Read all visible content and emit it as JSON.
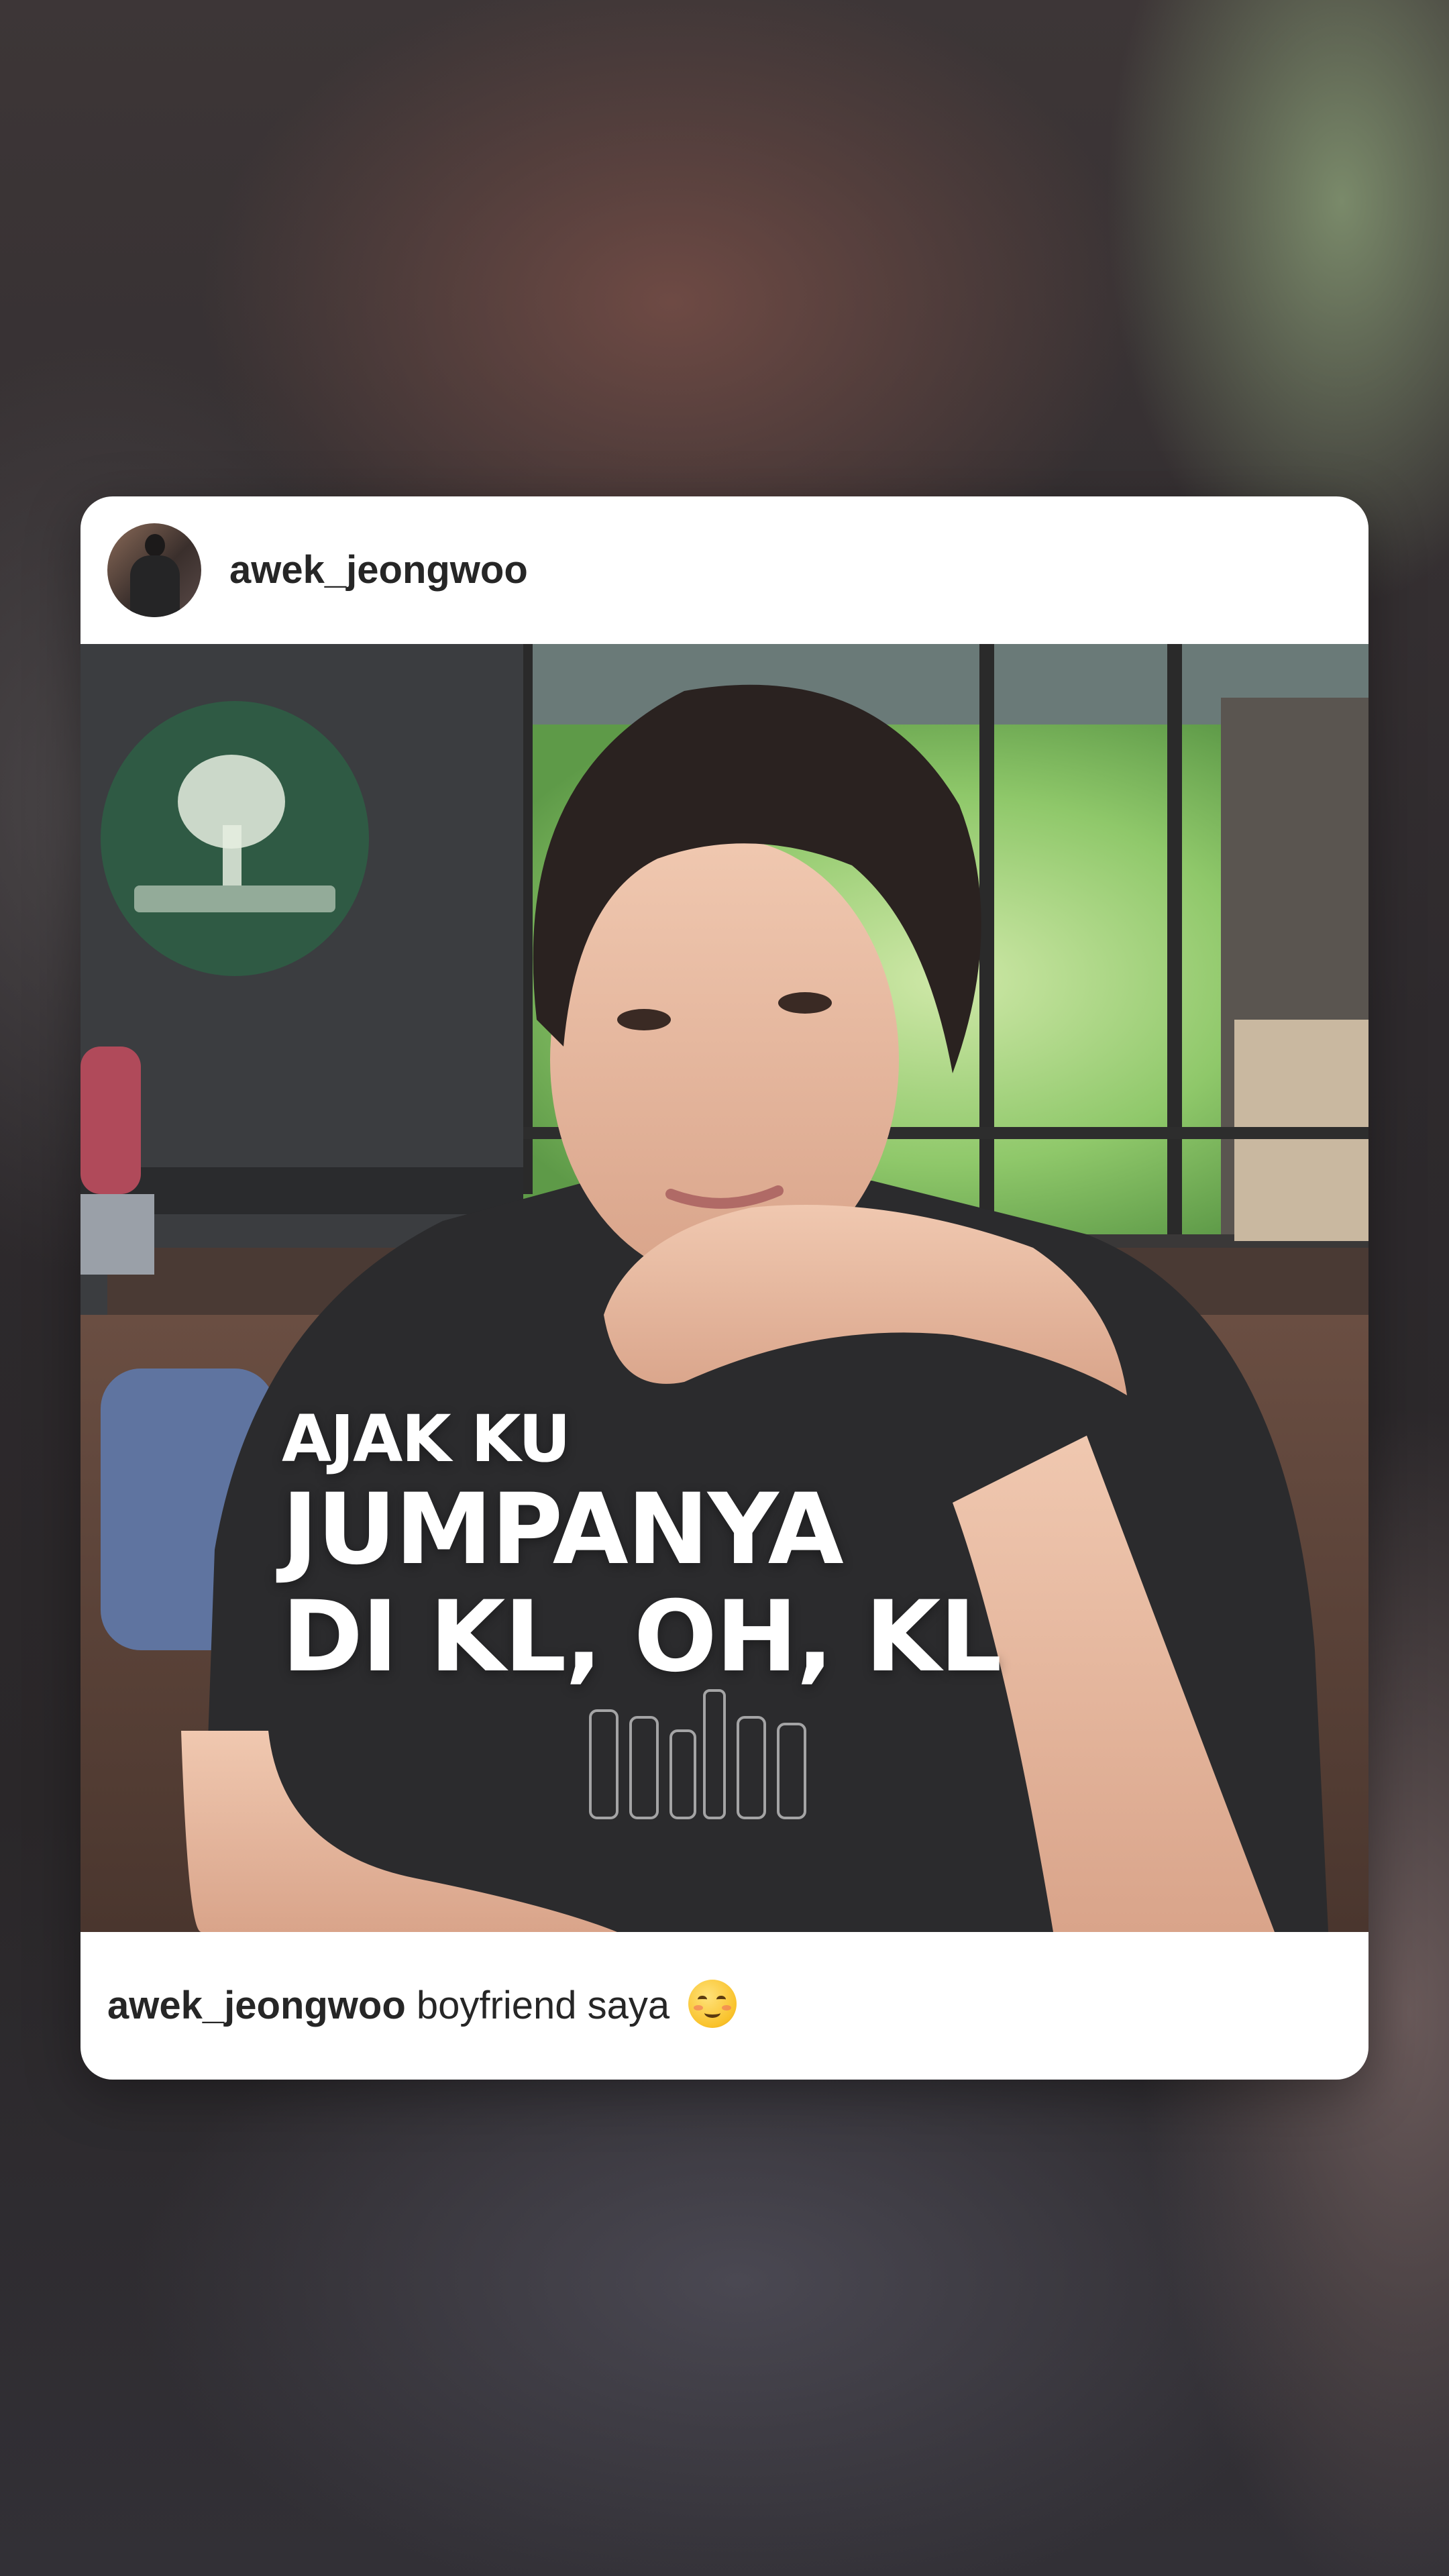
{
  "post": {
    "username": "awek_jeongwoo",
    "avatar_icon": "profile-avatar",
    "overlay": {
      "line1": "AJAK KU",
      "line2": "JUMPANYA",
      "line3": "DI KL, OH, KL"
    },
    "caption": {
      "username": "awek_jeongwoo",
      "text": "boyfriend saya",
      "emoji_icon": "smiling-face-emoji"
    }
  }
}
